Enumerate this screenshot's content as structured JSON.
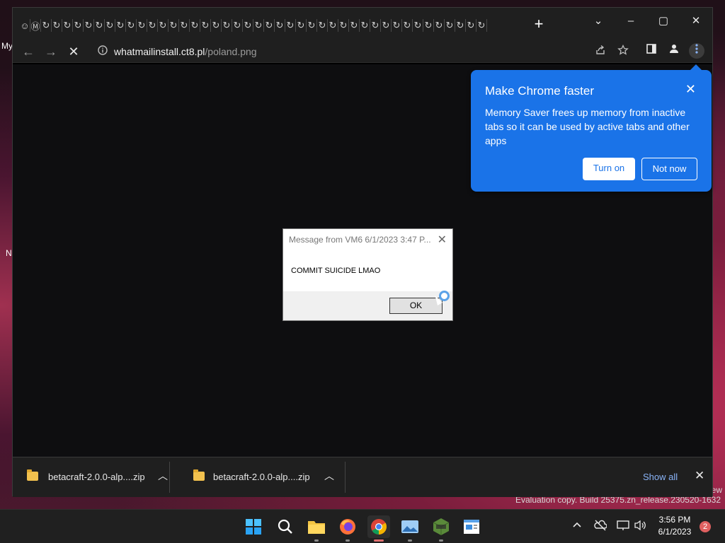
{
  "desktop": {
    "labels": [
      "My",
      "N"
    ],
    "watermark": "Evaluation copy. Build 25375.zn_release.230520-1632",
    "watermark_fragment": "ew"
  },
  "browser": {
    "tab_count": 44,
    "tab_icon_glyphs": [
      "☺",
      "Ⓜ"
    ],
    "new_tab": "+",
    "window_controls": {
      "dropdown": "⌄",
      "minimize": "–",
      "maximize": "▢",
      "close": "✕"
    },
    "toolbar": {
      "back": "←",
      "forward": "→",
      "stop": "✕"
    },
    "url": {
      "host": "whatmailinstall.ct8.pl",
      "path": "/poland.png"
    },
    "omnibox_icons": [
      "info-icon",
      "share-icon",
      "star-icon",
      "side-panel-icon",
      "profile-icon",
      "menu-icon"
    ]
  },
  "memory_saver": {
    "title": "Make Chrome faster",
    "body": "Memory Saver frees up memory from inactive tabs so it can be used by active tabs and other apps",
    "turn_on": "Turn on",
    "not_now": "Not now",
    "accent": "#1a73e8"
  },
  "downloads": {
    "items": [
      {
        "name": "betacraft-2.0.0-alp....zip"
      },
      {
        "name": "betacraft-2.0.0-alp....zip"
      }
    ],
    "show_all": "Show all",
    "close": "✕"
  },
  "message_box": {
    "title": "Message from VM6 6/1/2023 3:47 P...",
    "text": "COMMIT SUICIDE LMAO",
    "ok": "OK",
    "close": "✕"
  },
  "taskbar": {
    "apps": [
      "start-icon",
      "search-icon",
      "file-explorer-icon",
      "firefox-icon",
      "chrome-icon",
      "photos-icon",
      "betacraft-icon",
      "notepad-icon"
    ],
    "tray_icons": [
      "chevron-up-icon",
      "network-off-icon",
      "display-icon",
      "volume-icon"
    ],
    "time": "3:56 PM",
    "date": "6/1/2023",
    "notification_count": "2"
  }
}
